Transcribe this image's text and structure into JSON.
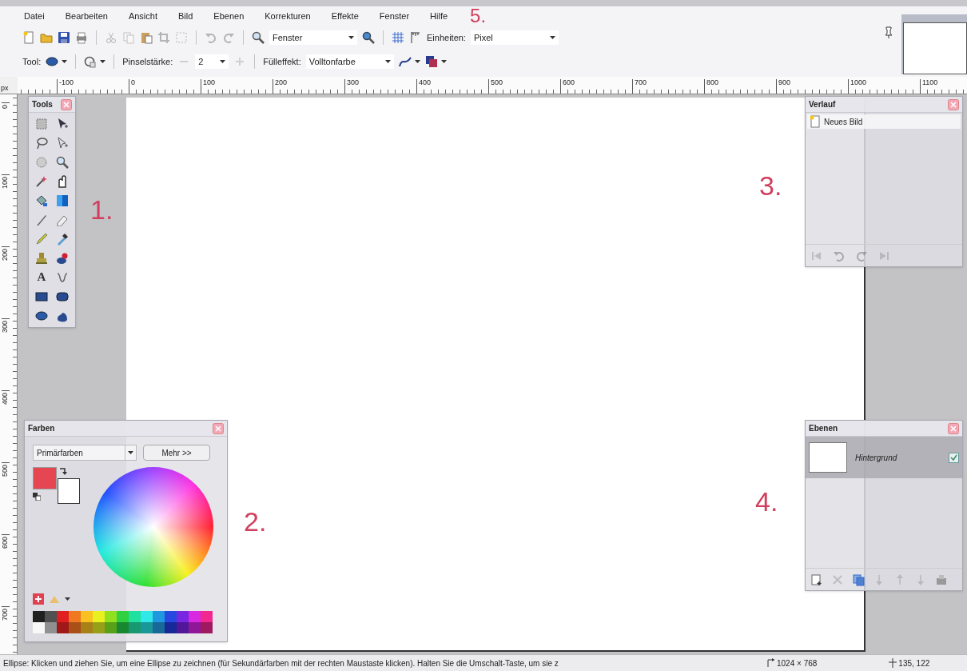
{
  "menu_bar": {
    "items": [
      "Datei",
      "Bearbeiten",
      "Ansicht",
      "Bild",
      "Ebenen",
      "Korrekturen",
      "Effekte",
      "Fenster",
      "Hilfe"
    ],
    "annotation": "5."
  },
  "toolbar": {
    "items": [
      {
        "kind": "new",
        "disabled": false
      },
      {
        "kind": "open",
        "disabled": false
      },
      {
        "kind": "save",
        "disabled": false
      },
      {
        "kind": "print",
        "disabled": false
      },
      {
        "kind": "separator"
      },
      {
        "kind": "cut",
        "disabled": true
      },
      {
        "kind": "copy",
        "disabled": true
      },
      {
        "kind": "paste",
        "disabled": false
      },
      {
        "kind": "crop",
        "disabled": true
      },
      {
        "kind": "deselect",
        "disabled": true
      },
      {
        "kind": "separator"
      },
      {
        "kind": "undo",
        "disabled": true
      },
      {
        "kind": "redo",
        "disabled": true
      },
      {
        "kind": "separator"
      },
      {
        "kind": "zoom",
        "disabled": false
      },
      {
        "kind": "dropdown",
        "value": "Fenster"
      },
      {
        "kind": "zoom_in",
        "disabled": false
      },
      {
        "kind": "separator"
      },
      {
        "kind": "grid",
        "disabled": false
      },
      {
        "kind": "ruler",
        "disabled": false
      },
      {
        "kind": "label",
        "text": "Einheiten:"
      },
      {
        "kind": "dropdown",
        "value": "Pixel"
      }
    ]
  },
  "tool_options": {
    "items": [
      {
        "kind": "label",
        "text": "Tool:"
      },
      {
        "kind": "ellipse_menu"
      },
      {
        "kind": "separator"
      },
      {
        "kind": "antialias_menu"
      },
      {
        "kind": "separator"
      },
      {
        "kind": "label",
        "text": "Pinselstärke:"
      },
      {
        "kind": "minus",
        "disabled": true
      },
      {
        "kind": "dropdown",
        "value": "2"
      },
      {
        "kind": "plus",
        "disabled": true
      },
      {
        "kind": "separator"
      },
      {
        "kind": "label",
        "text": "Fülleffekt:"
      },
      {
        "kind": "dropdown",
        "value": "Volltonfarbe"
      },
      {
        "kind": "curve_menu"
      },
      {
        "kind": "blend_menu"
      }
    ]
  },
  "rulers": {
    "unit": "px",
    "horizontal": [
      "-100",
      "0",
      "100",
      "200",
      "300",
      "400",
      "500",
      "600",
      "700",
      "800",
      "900",
      "1000",
      "1100"
    ],
    "vertical": [
      "0",
      "100",
      "200",
      "300",
      "400",
      "500",
      "600",
      "700"
    ]
  },
  "tools_panel": {
    "title": "Tools",
    "annotation": "1.",
    "tools": [
      {
        "kind": "rect_select"
      },
      {
        "kind": "move"
      },
      {
        "kind": "lasso"
      },
      {
        "kind": "move_selection"
      },
      {
        "kind": "ellipse_select"
      },
      {
        "kind": "zoom"
      },
      {
        "kind": "magic_wand"
      },
      {
        "kind": "pan"
      },
      {
        "kind": "bucket"
      },
      {
        "kind": "gradient"
      },
      {
        "kind": "brush"
      },
      {
        "kind": "eraser"
      },
      {
        "kind": "pencil"
      },
      {
        "kind": "picker"
      },
      {
        "kind": "stamp"
      },
      {
        "kind": "recolor"
      },
      {
        "kind": "text",
        "glyph": "A"
      },
      {
        "kind": "line"
      },
      {
        "kind": "rect"
      },
      {
        "kind": "roundrect"
      },
      {
        "kind": "ellipse"
      },
      {
        "kind": "freeform"
      }
    ]
  },
  "colors_panel": {
    "title": "Farben",
    "mode": "Primärfarben",
    "more_button": "Mehr >>",
    "annotation": "2.",
    "primary": {
      "color": "#e64552"
    },
    "secondary": {
      "color": "#ffffff"
    },
    "palette": [
      {
        "color": "#202020"
      },
      {
        "color": "#505050"
      },
      {
        "color": "#e02020"
      },
      {
        "color": "#f07820"
      },
      {
        "color": "#f8c020"
      },
      {
        "color": "#e8f020"
      },
      {
        "color": "#90e020"
      },
      {
        "color": "#30d040"
      },
      {
        "color": "#20e0a0"
      },
      {
        "color": "#30e8e8"
      },
      {
        "color": "#2098e0"
      },
      {
        "color": "#2848e0"
      },
      {
        "color": "#7828e0"
      },
      {
        "color": "#d828e0"
      },
      {
        "color": "#f02890"
      },
      {
        "color": "#f8f8f8"
      },
      {
        "color": "#909090"
      },
      {
        "color": "#a01818"
      },
      {
        "color": "#a85018"
      },
      {
        "color": "#a88018"
      },
      {
        "color": "#98a018"
      },
      {
        "color": "#58a018"
      },
      {
        "color": "#188830"
      },
      {
        "color": "#189870"
      },
      {
        "color": "#189898"
      },
      {
        "color": "#186898"
      },
      {
        "color": "#182898"
      },
      {
        "color": "#501898"
      },
      {
        "color": "#901898"
      },
      {
        "color": "#a01860"
      }
    ]
  },
  "history_panel": {
    "title": "Verlauf",
    "annotation": "3.",
    "items": [
      {
        "label": "Neues Bild",
        "selected": true
      }
    ],
    "buttons": [
      {
        "kind": "first",
        "disabled": true
      },
      {
        "kind": "undo",
        "disabled": true
      },
      {
        "kind": "redo",
        "disabled": true
      },
      {
        "kind": "last",
        "disabled": true
      }
    ]
  },
  "layers_panel": {
    "title": "Ebenen",
    "annotation": "4.",
    "layers": [
      {
        "name": "Hintergrund",
        "selected": true,
        "visible": true
      }
    ],
    "buttons": [
      {
        "kind": "add_layer",
        "disabled": false
      },
      {
        "kind": "delete",
        "disabled": true
      },
      {
        "kind": "duplicate",
        "disabled": false
      },
      {
        "kind": "merge",
        "disabled": true
      },
      {
        "kind": "up",
        "disabled": true
      },
      {
        "kind": "down",
        "disabled": true
      },
      {
        "kind": "properties",
        "disabled": false
      }
    ]
  },
  "status_bar": {
    "hint": "Ellipse: Klicken und ziehen Sie, um eine Ellipse zu zeichnen (für Sekundärfarben mit der rechten Maustaste klicken). Halten Sie die Umschalt-Taste, um sie z",
    "image_size": "1024 × 768",
    "cursor_position": "135, 122"
  }
}
